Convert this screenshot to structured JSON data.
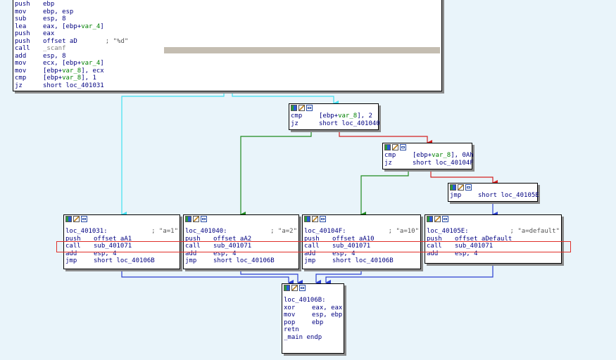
{
  "main_block": {
    "lines": [
      {
        "mn": "push",
        "op": "ebp"
      },
      {
        "mn": "mov",
        "op": "ebp, esp"
      },
      {
        "mn": "sub",
        "op": "esp, 8"
      },
      {
        "mn": "lea",
        "op": "eax, [ebp+var_4]"
      },
      {
        "mn": "push",
        "op": "eax"
      },
      {
        "mn": "push",
        "op": "offset aD",
        "comment": "; \"%d\""
      },
      {
        "mn": "call",
        "op": "_scanf"
      },
      {
        "mn": "add",
        "op": "esp, 8"
      },
      {
        "mn": "mov",
        "op": "ecx, [ebp+var_4]"
      },
      {
        "mn": "mov",
        "op": "[ebp+var_8], ecx"
      },
      {
        "mn": "cmp",
        "op": "[ebp+var_8], 1"
      },
      {
        "mn": "jz",
        "op": "short loc_401031"
      }
    ]
  },
  "cmp2_block": {
    "lines": [
      {
        "mn": "cmp",
        "op": "[ebp+var_8], 2"
      },
      {
        "mn": "jz",
        "op": "short loc_401040"
      }
    ]
  },
  "cmp10_block": {
    "lines": [
      {
        "mn": "cmp",
        "op": "[ebp+var_8], 0Ah"
      },
      {
        "mn": "jz",
        "op": "short loc_40104F"
      }
    ]
  },
  "jmp_block": {
    "lines": [
      {
        "mn": "jmp",
        "op": "short loc_40105E"
      }
    ]
  },
  "case_blocks": [
    {
      "label": "loc_401031:",
      "comment": "; \"a=1\"",
      "lines": [
        {
          "mn": "push",
          "op": "offset aA1"
        },
        {
          "mn": "call",
          "op": "sub_401071"
        },
        {
          "mn": "add",
          "op": "esp, 4"
        },
        {
          "mn": "jmp",
          "op": "short loc_40106B"
        }
      ]
    },
    {
      "label": "loc_401040:",
      "comment": "; \"a=2\"",
      "lines": [
        {
          "mn": "push",
          "op": "offset aA2"
        },
        {
          "mn": "call",
          "op": "sub_401071"
        },
        {
          "mn": "add",
          "op": "esp, 4"
        },
        {
          "mn": "jmp",
          "op": "short loc_40106B"
        }
      ]
    },
    {
      "label": "loc_40104F:",
      "comment": "; \"a=10\"",
      "lines": [
        {
          "mn": "push",
          "op": "offset aA10"
        },
        {
          "mn": "call",
          "op": "sub_401071"
        },
        {
          "mn": "add",
          "op": "esp, 4"
        },
        {
          "mn": "jmp",
          "op": "short loc_40106B"
        }
      ]
    },
    {
      "label": "loc_40105E:",
      "comment": "; \"a=default\"",
      "lines": [
        {
          "mn": "push",
          "op": "offset aDefault"
        },
        {
          "mn": "call",
          "op": "sub_401071"
        },
        {
          "mn": "add",
          "op": "esp, 4"
        }
      ]
    }
  ],
  "end_block": {
    "label": "loc_40106B:",
    "lines": [
      {
        "mn": "xor",
        "op": "eax, eax"
      },
      {
        "mn": "mov",
        "op": "esp, ebp"
      },
      {
        "mn": "pop",
        "op": "ebp"
      },
      {
        "mn": "retn",
        "op": ""
      }
    ],
    "footer": "_main endp"
  },
  "colors": {
    "background": "#e9f4fa",
    "edge_unconditional": "#2b3fd0",
    "edge_true": "#1f8a1f",
    "edge_false": "#d42020",
    "edge_highlight": "#40e0f0",
    "selection_box": "#e0302a"
  }
}
